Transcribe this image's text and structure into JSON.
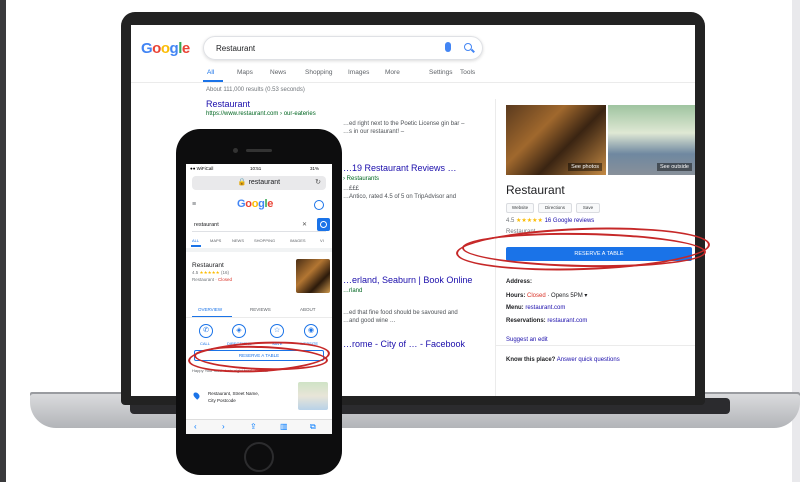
{
  "laptop": {
    "logo": [
      "G",
      "o",
      "o",
      "g",
      "l",
      "e"
    ],
    "logo_colors": [
      "#4285f4",
      "#ea4335",
      "#fbbc05",
      "#4285f4",
      "#34a853",
      "#ea4335"
    ],
    "search_query": "Restaurant",
    "nav": [
      "All",
      "Maps",
      "News",
      "Shopping",
      "Images",
      "More",
      "Settings",
      "Tools"
    ],
    "results_count": "About 111,000 results (0.53 seconds)",
    "results": [
      {
        "title": "Restaurant",
        "url": "https://www.restaurant.com › our-eateries",
        "snippet_1": "…ed right next to the Poetic License gin bar –",
        "snippet_2": "…s in our restaurant! –"
      },
      {
        "title": "…19 Restaurant Reviews …",
        "url": "› Restaurants",
        "snippet_1": "…£££",
        "snippet_2": "…Antico, rated 4.5 of 5 on TripAdvisor and"
      },
      {
        "title": "…erland, Seaburn | Book Online",
        "url": "…rland",
        "snippet_1": "…ed that fine food should be savoured and",
        "snippet_2": "…and good wine …"
      },
      {
        "title": "…rome - City of … - Facebook",
        "url": "",
        "snippet_1": "",
        "snippet_2": ""
      }
    ],
    "kp": {
      "name": "Restaurant",
      "photo1_caption": "See photos",
      "photo2_caption": "See outside",
      "buttons": [
        "Website",
        "Directions",
        "Save"
      ],
      "rating": "4.5",
      "stars": "★★★★★",
      "reviews": "16 Google reviews",
      "category": "Restaurant",
      "reserve": "RESERVE A TABLE",
      "address_label": "Address:",
      "hours_label": "Hours:",
      "hours_closed": "Closed",
      "hours_rest": "· Opens 5PM ▾",
      "menu_label": "Menu:",
      "menu_value": "restaurant.com",
      "reservations_label": "Reservations:",
      "reservations_value": "restaurant.com",
      "suggest_edit": "Suggest an edit",
      "know_label": "Know this place?",
      "know_link": "Answer quick questions"
    }
  },
  "phone": {
    "status_left": "●● WiFiCall",
    "status_time": "10:51",
    "status_right": "31%",
    "url": "🔒 restaurant",
    "reload": "↻",
    "menu_icon": "≡",
    "logo": [
      "G",
      "o",
      "o",
      "g",
      "l",
      "e"
    ],
    "search_query": "restaurant",
    "clear": "✕",
    "tabs": [
      "ALL",
      "MAPS",
      "NEWS",
      "SHOPPING",
      "IMAGES",
      "VI"
    ],
    "name": "Restaurant",
    "rating": "4.5",
    "stars": "★★★★★",
    "reviews": "(16)",
    "type": "Restaurant ·",
    "closed": "Closed",
    "segments": [
      "OVERVIEW",
      "REVIEWS",
      "ABOUT"
    ],
    "actions": [
      {
        "label": "CALL",
        "glyph": "✆"
      },
      {
        "label": "DIRECTIONS",
        "glyph": "◈"
      },
      {
        "label": "SAVE",
        "glyph": "☆"
      },
      {
        "label": "WEBSITE",
        "glyph": "◉"
      }
    ],
    "reserve": "RESERVE A TABLE",
    "happy": "Happy Your food · Late night food · Casual",
    "addr_1": "Restaurant, Street Name,",
    "addr_2": "City Postcode",
    "toolbar": [
      "‹",
      "›",
      "⇪",
      "▥",
      "⧉"
    ]
  },
  "colors": {
    "link": "#1a0dab",
    "url": "#006621",
    "accent": "#1a73e8",
    "closed": "#d93025",
    "star": "#fbbc04",
    "annotation": "#c62828"
  }
}
